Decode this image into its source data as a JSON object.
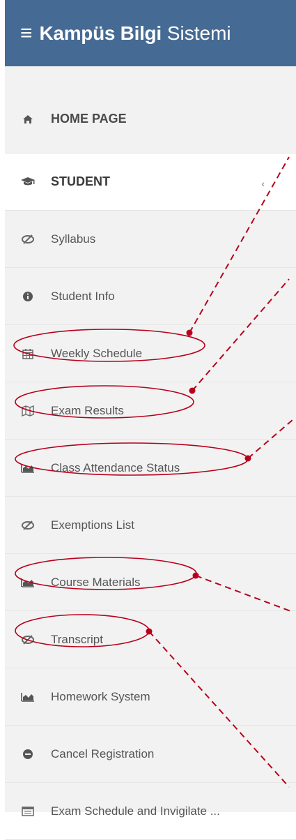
{
  "header": {
    "menu_icon": "hamburger-icon",
    "title_bold": "Kampüs Bilgi",
    "title_light": "Sistemi"
  },
  "nav": {
    "home": {
      "label": "HOME PAGE",
      "icon": "home-icon"
    },
    "student": {
      "label": "STUDENT",
      "icon": "graduation-cap-icon"
    },
    "items": [
      {
        "label": "Syllabus",
        "icon": "eye-slash-icon"
      },
      {
        "label": "Student Info",
        "icon": "info-circle-icon"
      },
      {
        "label": "Weekly Schedule",
        "icon": "calendar-icon"
      },
      {
        "label": "Exam Results",
        "icon": "map-icon"
      },
      {
        "label": "Class Attendance Status",
        "icon": "area-chart-icon"
      },
      {
        "label": "Exemptions List",
        "icon": "eye-slash-icon"
      },
      {
        "label": "Course Materials",
        "icon": "area-chart-icon"
      },
      {
        "label": "Transcript",
        "icon": "eye-slash-icon"
      },
      {
        "label": "Homework System",
        "icon": "area-chart-icon"
      },
      {
        "label": "Cancel Registration",
        "icon": "minus-circle-icon"
      },
      {
        "label": "Exam Schedule and Invigilate ...",
        "icon": "list-alt-icon"
      }
    ]
  },
  "annotations": {
    "color": "#b8001c"
  }
}
